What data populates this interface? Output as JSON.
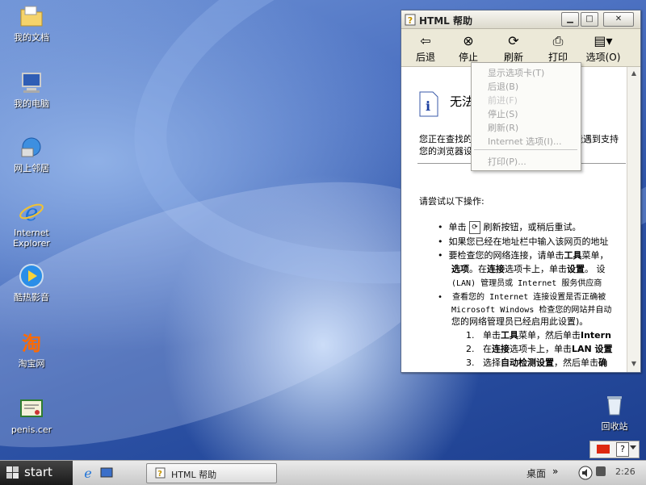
{
  "desktop": {
    "icons": [
      {
        "label": "我的文档",
        "icon": "folder-icon"
      },
      {
        "label": "我的电脑",
        "icon": "computer-icon"
      },
      {
        "label": "网上邻居",
        "icon": "network-icon"
      },
      {
        "label": "Internet Explorer",
        "icon": "ie-icon"
      },
      {
        "label": "酷热影音",
        "icon": "media-player-icon"
      },
      {
        "label": "淘宝网",
        "icon": "taobao-icon"
      },
      {
        "label": "penis.cer",
        "icon": "certificate-icon"
      },
      {
        "label": "回收站",
        "icon": "recycle-bin-icon"
      }
    ]
  },
  "window": {
    "title": "HTML 帮助",
    "toolbar": [
      {
        "label": "后退",
        "icon": "back-arrow-icon"
      },
      {
        "label": "停止",
        "icon": "stop-icon"
      },
      {
        "label": "刷新",
        "icon": "refresh-icon"
      },
      {
        "label": "打印",
        "icon": "print-icon"
      },
      {
        "label": "选项(O)",
        "icon": "options-icon"
      }
    ],
    "content": {
      "heading": "无法",
      "intro_line1": "您正在查找的",
      "intro_line1_tail": "能遇到支持",
      "intro_line2": "您的浏览器设",
      "try_text": "请尝试以下操作:",
      "bullets": [
        {
          "pre": "单击",
          "post": " 刷新按钮，或稍后重试。"
        },
        {
          "text": "如果您已经在地址栏中输入该网页的地址"
        },
        {
          "text_a": "要检查您的网络连接，请单击",
          "bold_a": "工具",
          "text_b": "菜单，",
          "line2_bold": "选项",
          "line2_mid": "。在",
          "line2_bold2": "连接",
          "line2_end": "选项卡上，单击",
          "line2_bold3": "设置",
          "line2_tail": "。 设",
          "line3": "(LAN) 管理员或 Internet 服务供应商"
        },
        {
          "line1": "查看您的 Internet 连接设置是否正确被",
          "line2": "Microsoft Windows 检查您的网站并自动",
          "line3": "您的网络管理员已经启用此设置)。"
        }
      ],
      "steps": [
        {
          "num": "1.",
          "pre": "单击",
          "bold": "工具",
          "post": "菜单，然后单击",
          "bold2": "Intern"
        },
        {
          "num": "2.",
          "pre": "在",
          "bold": "连接",
          "post": "选项卡上，单击",
          "bold2": "LAN 设置"
        },
        {
          "num": "3.",
          "pre": "选择",
          "bold": "自动检测设置",
          "post": "，然后单击",
          "bold2": "确"
        }
      ]
    }
  },
  "menu": {
    "items": [
      "显示选项卡(T)",
      "后退(B)",
      "前进(F)",
      "停止(S)",
      "刷新(R)",
      "Internet 选项(I)..."
    ],
    "print_item": "打印(P)..."
  },
  "taskbar": {
    "start_label": "start",
    "task_label": "HTML 帮助",
    "desktop_label": "桌面",
    "clock": "2:26",
    "lang": "CH"
  }
}
